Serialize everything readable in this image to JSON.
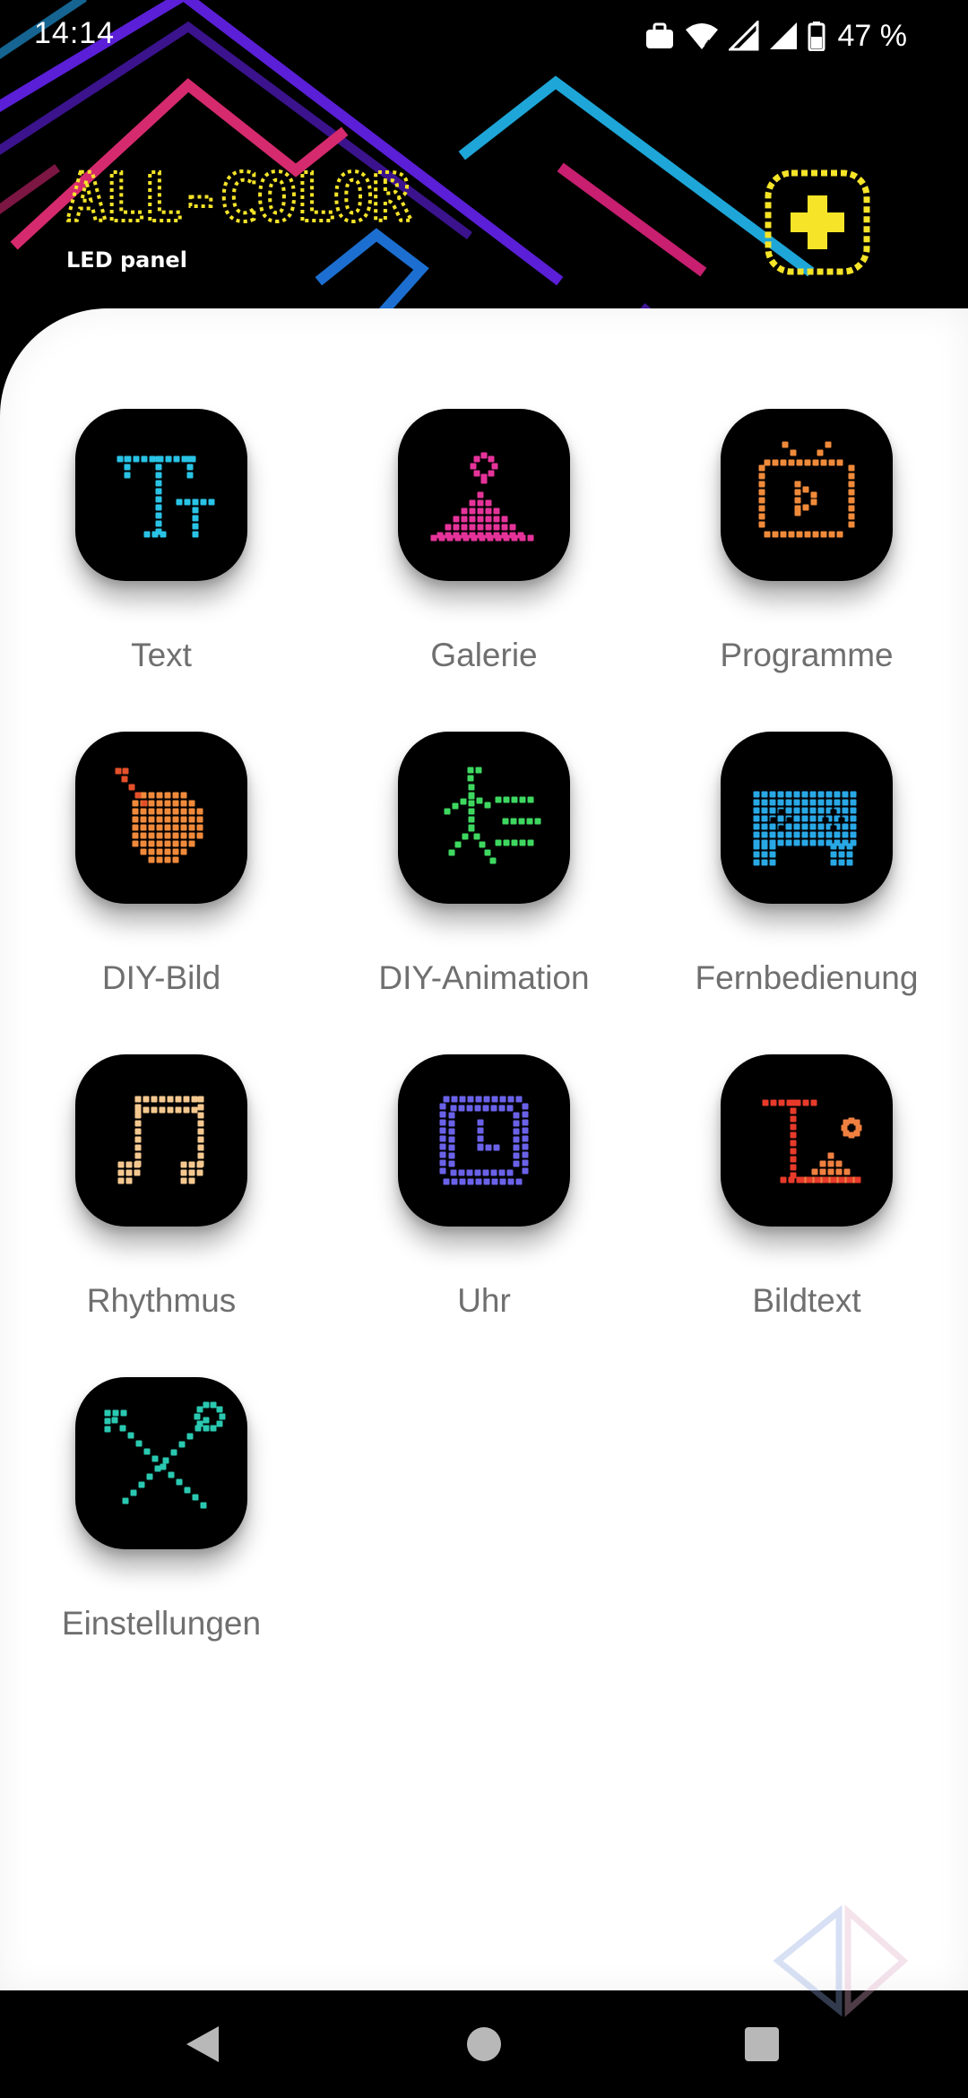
{
  "status_bar": {
    "time": "14:14",
    "battery_text": "47 %",
    "icons": [
      "work-profile-icon",
      "wifi-icon",
      "signal-icon",
      "signal-icon",
      "battery-icon"
    ]
  },
  "header": {
    "logo_text": "ALL-COLOR",
    "logo_subtitle": "LED panel",
    "logo_color": "#f5e428",
    "add_button_icon": "plus-icon"
  },
  "tiles": [
    {
      "label": "Text",
      "icon": "text-icon",
      "color": "#29c3e6"
    },
    {
      "label": "Galerie",
      "icon": "gallery-icon",
      "color": "#e6339a"
    },
    {
      "label": "Programme",
      "icon": "tv-icon",
      "color": "#f08a3a"
    },
    {
      "label": "DIY-Bild",
      "icon": "palette-icon",
      "color": "#f08a3a"
    },
    {
      "label": "DIY-Animation",
      "icon": "running-man-icon",
      "color": "#3ed860"
    },
    {
      "label": "Fernbedienung",
      "icon": "gamepad-icon",
      "color": "#29a8e6"
    },
    {
      "label": "Rhythmus",
      "icon": "music-note-icon",
      "color": "#f5c890"
    },
    {
      "label": "Uhr",
      "icon": "clock-icon",
      "color": "#6a62e8"
    },
    {
      "label": "Bildtext",
      "icon": "image-text-icon",
      "color": "#e83a2a"
    },
    {
      "label": "Einstellungen",
      "icon": "tools-icon",
      "color": "#2ac8b0"
    }
  ],
  "nav_bar": {
    "back_icon": "back-icon",
    "home_icon": "home-icon",
    "recents_icon": "recents-icon"
  },
  "watermark_icon": "watermark-logo-icon"
}
